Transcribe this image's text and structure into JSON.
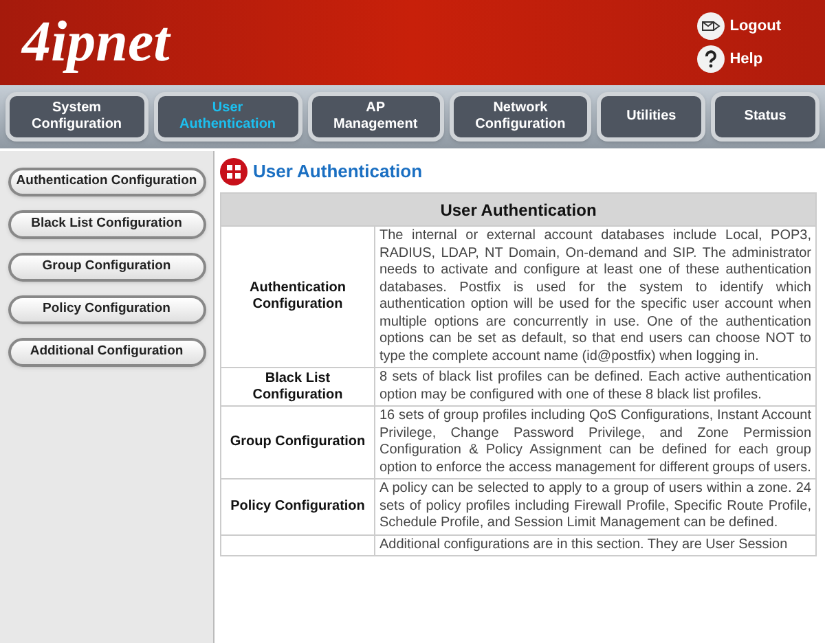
{
  "header": {
    "logo": "4ipnet",
    "links": [
      {
        "kind": "logout",
        "label": "Logout"
      },
      {
        "kind": "help",
        "label": "Help"
      }
    ]
  },
  "tabs": [
    {
      "label": "System Configuration",
      "selected": false
    },
    {
      "label": "User Authentication",
      "selected": true
    },
    {
      "label": "AP Management",
      "selected": false
    },
    {
      "label": "Network Configuration",
      "selected": false
    },
    {
      "label": "Utilities",
      "selected": false
    },
    {
      "label": "Status",
      "selected": false
    }
  ],
  "sidebar": {
    "items": [
      "Authentication Configuration",
      "Black List Configuration",
      "Group Configuration",
      "Policy Configuration",
      "Additional Configuration"
    ]
  },
  "page_title": "User Authentication",
  "table": {
    "title": "User Authentication",
    "rows": [
      {
        "label": "Authentication Configuration",
        "description": "The internal or external account databases include Local, POP3, RADIUS, LDAP, NT Domain, On-demand and SIP. The administrator needs to activate and configure at least one of these authentication databases. Postfix is used for the system to identify which authentication option will be used for the specific user account when multiple options are concurrently in use. One of the authentication options can be set as default, so that end users can choose NOT to type the complete account name (id@postfix) when logging in."
      },
      {
        "label": "Black List Configuration",
        "description": "8 sets of black list profiles can be defined. Each active authentication option may be configured with one of these 8 black list profiles."
      },
      {
        "label": "Group Configuration",
        "description": "16 sets of group profiles including QoS Configurations, Instant Account Privilege, Change Password Privilege, and Zone Permission Configuration & Policy Assignment can be defined for each group option to enforce the access management for different groups of users."
      },
      {
        "label": "Policy Configuration",
        "description": "A policy can be selected to apply to a group of users within a zone. 24 sets of policy profiles including Firewall Profile, Specific Route Profile, Schedule Profile, and Session Limit Management can be defined."
      },
      {
        "label": "",
        "description": "Additional configurations are in this section. They are User Session"
      }
    ]
  }
}
